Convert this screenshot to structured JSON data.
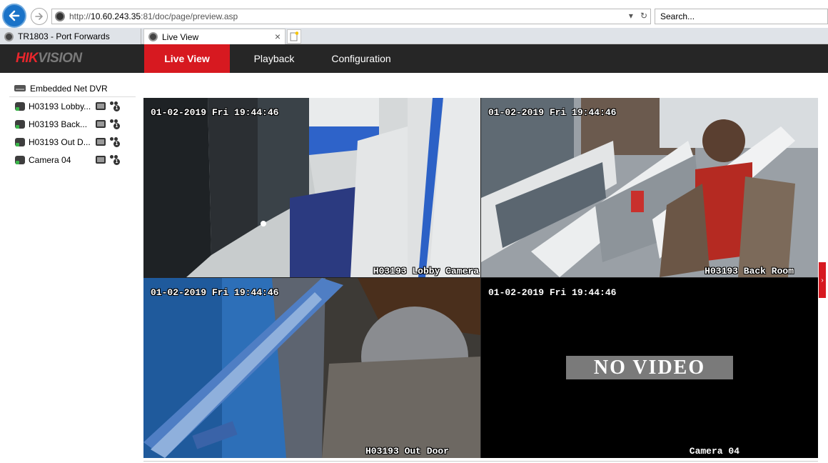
{
  "browser": {
    "url_prefix": "http://",
    "url_host": "10.60.243.35",
    "url_rest": ":81/doc/page/preview.asp",
    "search_placeholder": "Search...",
    "tabs": [
      {
        "label": "TR1803 - Port Forwards",
        "active": false
      },
      {
        "label": "Live View",
        "active": true
      }
    ],
    "back_icon": "back-arrow-icon",
    "forward_icon": "forward-arrow-icon"
  },
  "app": {
    "brand_part1": "HIK",
    "brand_part2": "VISION",
    "brand_color": "#e8262c",
    "header_bg": "#262626",
    "nav": [
      {
        "label": "Live View",
        "active": true
      },
      {
        "label": "Playback",
        "active": false
      },
      {
        "label": "Configuration",
        "active": false
      }
    ],
    "accent": "#d71920"
  },
  "sidebar": {
    "device_label": "Embedded Net DVR",
    "cameras": [
      {
        "label": "H03193 Lobby Camera",
        "display": "H03193 Lobby..."
      },
      {
        "label": "H03193 Back Room",
        "display": "H03193 Back..."
      },
      {
        "label": "H03193 Out Door",
        "display": "H03193 Out D..."
      },
      {
        "label": "Camera 04",
        "display": "Camera 04"
      }
    ]
  },
  "video": {
    "tiles": [
      {
        "datetime": "01-02-2019 Fri 19:44:46",
        "name": "H03193 Lobby Camera",
        "selected": true,
        "no_video": false
      },
      {
        "datetime": "01-02-2019 Fri 19:44:46",
        "name": "H03193 Back Room",
        "selected": false,
        "no_video": false
      },
      {
        "datetime": "01-02-2019 Fri 19:44:46",
        "name": "H03193 Out Door",
        "selected": false,
        "no_video": false
      },
      {
        "datetime": "01-02-2019 Fri 19:44:46",
        "name": "Camera 04",
        "selected": false,
        "no_video": true
      }
    ],
    "no_video_label": "NO VIDEO"
  }
}
